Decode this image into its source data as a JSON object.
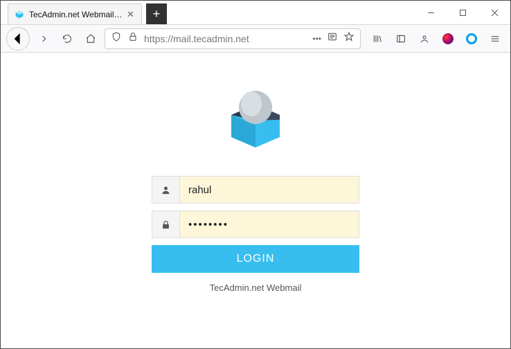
{
  "window": {
    "tab_title": "TecAdmin.net Webmail :: Welc",
    "url_display": "https://mail.tecadmin.net"
  },
  "toolbar": {
    "url_prefix": "https://",
    "url_host": "mail.tecadmin.net",
    "dots": "•••"
  },
  "login": {
    "username_value": "rahul",
    "password_value": "••••••••",
    "button_label": "LOGIN",
    "footer": "TecAdmin.net Webmail"
  }
}
